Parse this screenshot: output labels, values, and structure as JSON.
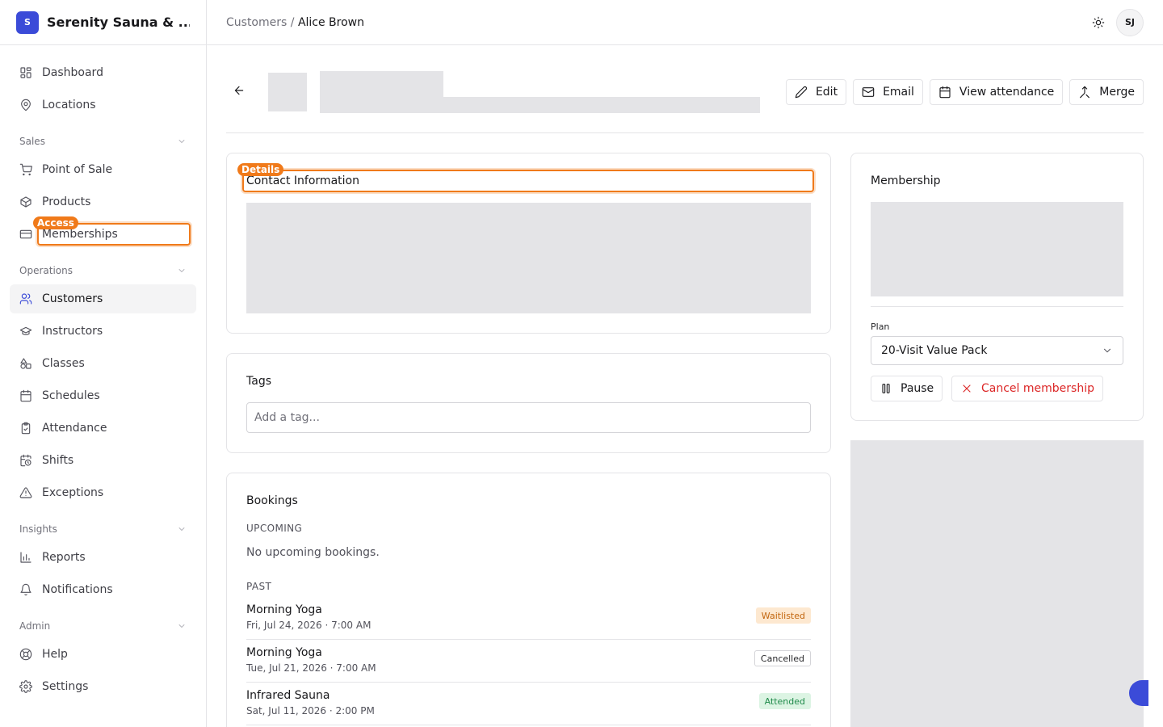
{
  "brand": {
    "logo_letter": "S",
    "name": "Serenity Sauna & ..."
  },
  "sidebar": {
    "items_top": [
      {
        "label": "Dashboard",
        "icon": "dashboard-icon"
      },
      {
        "label": "Locations",
        "icon": "map-pin-icon"
      }
    ],
    "groups": [
      {
        "label": "Sales",
        "items": [
          {
            "label": "Point of Sale",
            "icon": "cart-icon"
          },
          {
            "label": "Products",
            "icon": "package-icon"
          },
          {
            "label": "Memberships",
            "icon": "card-icon"
          }
        ]
      },
      {
        "label": "Operations",
        "items": [
          {
            "label": "Customers",
            "icon": "users-icon",
            "active": true
          },
          {
            "label": "Instructors",
            "icon": "graduation-cap-icon"
          },
          {
            "label": "Classes",
            "icon": "shapes-icon"
          },
          {
            "label": "Schedules",
            "icon": "calendar-icon"
          },
          {
            "label": "Attendance",
            "icon": "clipboard-check-icon"
          },
          {
            "label": "Shifts",
            "icon": "calendar-clock-icon"
          },
          {
            "label": "Exceptions",
            "icon": "alert-triangle-icon"
          }
        ]
      },
      {
        "label": "Insights",
        "items": [
          {
            "label": "Reports",
            "icon": "bar-chart-icon"
          },
          {
            "label": "Notifications",
            "icon": "bell-icon"
          }
        ]
      },
      {
        "label": "Admin",
        "items": [
          {
            "label": "Help",
            "icon": "life-buoy-icon"
          },
          {
            "label": "Settings",
            "icon": "gear-icon"
          }
        ]
      }
    ]
  },
  "header": {
    "breadcrumb_parent": "Customers",
    "breadcrumb_sep": "/",
    "breadcrumb_current": "Alice Brown",
    "avatar_initials": "SJ"
  },
  "actions": {
    "edit": "Edit",
    "email": "Email",
    "view_attendance": "View attendance",
    "merge": "Merge"
  },
  "contact": {
    "title": "Contact Information"
  },
  "tags": {
    "title": "Tags",
    "placeholder": "Add a tag..."
  },
  "bookings": {
    "title": "Bookings",
    "upcoming_label": "UPCOMING",
    "upcoming_empty": "No upcoming bookings.",
    "past_label": "PAST",
    "past": [
      {
        "name": "Morning Yoga",
        "date": "Fri, Jul 24, 2026 · 7:00 AM",
        "status": "Waitlisted"
      },
      {
        "name": "Morning Yoga",
        "date": "Tue, Jul 21, 2026 · 7:00 AM",
        "status": "Cancelled"
      },
      {
        "name": "Infrared Sauna",
        "date": "Sat, Jul 11, 2026 · 2:00 PM",
        "status": "Attended"
      }
    ]
  },
  "membership": {
    "title": "Membership",
    "plan_label": "Plan",
    "plan_value": "20-Visit Value Pack",
    "pause": "Pause",
    "cancel": "Cancel membership"
  },
  "highlights": {
    "details": "Details",
    "access": "Access"
  },
  "colors": {
    "accent": "#3b4bd8",
    "highlight": "#f07a1a",
    "danger": "#dc2626"
  }
}
